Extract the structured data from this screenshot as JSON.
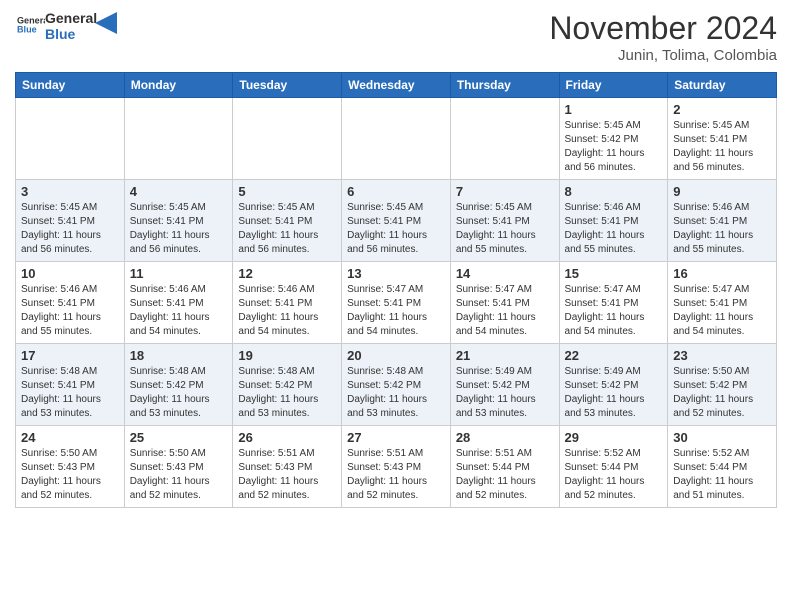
{
  "header": {
    "logo_general": "General",
    "logo_blue": "Blue",
    "month_title": "November 2024",
    "location": "Junin, Tolima, Colombia"
  },
  "calendar": {
    "days_of_week": [
      "Sunday",
      "Monday",
      "Tuesday",
      "Wednesday",
      "Thursday",
      "Friday",
      "Saturday"
    ],
    "weeks": [
      [
        {
          "day": "",
          "info": ""
        },
        {
          "day": "",
          "info": ""
        },
        {
          "day": "",
          "info": ""
        },
        {
          "day": "",
          "info": ""
        },
        {
          "day": "",
          "info": ""
        },
        {
          "day": "1",
          "info": "Sunrise: 5:45 AM\nSunset: 5:42 PM\nDaylight: 11 hours\nand 56 minutes."
        },
        {
          "day": "2",
          "info": "Sunrise: 5:45 AM\nSunset: 5:41 PM\nDaylight: 11 hours\nand 56 minutes."
        }
      ],
      [
        {
          "day": "3",
          "info": "Sunrise: 5:45 AM\nSunset: 5:41 PM\nDaylight: 11 hours\nand 56 minutes."
        },
        {
          "day": "4",
          "info": "Sunrise: 5:45 AM\nSunset: 5:41 PM\nDaylight: 11 hours\nand 56 minutes."
        },
        {
          "day": "5",
          "info": "Sunrise: 5:45 AM\nSunset: 5:41 PM\nDaylight: 11 hours\nand 56 minutes."
        },
        {
          "day": "6",
          "info": "Sunrise: 5:45 AM\nSunset: 5:41 PM\nDaylight: 11 hours\nand 56 minutes."
        },
        {
          "day": "7",
          "info": "Sunrise: 5:45 AM\nSunset: 5:41 PM\nDaylight: 11 hours\nand 55 minutes."
        },
        {
          "day": "8",
          "info": "Sunrise: 5:46 AM\nSunset: 5:41 PM\nDaylight: 11 hours\nand 55 minutes."
        },
        {
          "day": "9",
          "info": "Sunrise: 5:46 AM\nSunset: 5:41 PM\nDaylight: 11 hours\nand 55 minutes."
        }
      ],
      [
        {
          "day": "10",
          "info": "Sunrise: 5:46 AM\nSunset: 5:41 PM\nDaylight: 11 hours\nand 55 minutes."
        },
        {
          "day": "11",
          "info": "Sunrise: 5:46 AM\nSunset: 5:41 PM\nDaylight: 11 hours\nand 54 minutes."
        },
        {
          "day": "12",
          "info": "Sunrise: 5:46 AM\nSunset: 5:41 PM\nDaylight: 11 hours\nand 54 minutes."
        },
        {
          "day": "13",
          "info": "Sunrise: 5:47 AM\nSunset: 5:41 PM\nDaylight: 11 hours\nand 54 minutes."
        },
        {
          "day": "14",
          "info": "Sunrise: 5:47 AM\nSunset: 5:41 PM\nDaylight: 11 hours\nand 54 minutes."
        },
        {
          "day": "15",
          "info": "Sunrise: 5:47 AM\nSunset: 5:41 PM\nDaylight: 11 hours\nand 54 minutes."
        },
        {
          "day": "16",
          "info": "Sunrise: 5:47 AM\nSunset: 5:41 PM\nDaylight: 11 hours\nand 54 minutes."
        }
      ],
      [
        {
          "day": "17",
          "info": "Sunrise: 5:48 AM\nSunset: 5:41 PM\nDaylight: 11 hours\nand 53 minutes."
        },
        {
          "day": "18",
          "info": "Sunrise: 5:48 AM\nSunset: 5:42 PM\nDaylight: 11 hours\nand 53 minutes."
        },
        {
          "day": "19",
          "info": "Sunrise: 5:48 AM\nSunset: 5:42 PM\nDaylight: 11 hours\nand 53 minutes."
        },
        {
          "day": "20",
          "info": "Sunrise: 5:48 AM\nSunset: 5:42 PM\nDaylight: 11 hours\nand 53 minutes."
        },
        {
          "day": "21",
          "info": "Sunrise: 5:49 AM\nSunset: 5:42 PM\nDaylight: 11 hours\nand 53 minutes."
        },
        {
          "day": "22",
          "info": "Sunrise: 5:49 AM\nSunset: 5:42 PM\nDaylight: 11 hours\nand 53 minutes."
        },
        {
          "day": "23",
          "info": "Sunrise: 5:50 AM\nSunset: 5:42 PM\nDaylight: 11 hours\nand 52 minutes."
        }
      ],
      [
        {
          "day": "24",
          "info": "Sunrise: 5:50 AM\nSunset: 5:43 PM\nDaylight: 11 hours\nand 52 minutes."
        },
        {
          "day": "25",
          "info": "Sunrise: 5:50 AM\nSunset: 5:43 PM\nDaylight: 11 hours\nand 52 minutes."
        },
        {
          "day": "26",
          "info": "Sunrise: 5:51 AM\nSunset: 5:43 PM\nDaylight: 11 hours\nand 52 minutes."
        },
        {
          "day": "27",
          "info": "Sunrise: 5:51 AM\nSunset: 5:43 PM\nDaylight: 11 hours\nand 52 minutes."
        },
        {
          "day": "28",
          "info": "Sunrise: 5:51 AM\nSunset: 5:44 PM\nDaylight: 11 hours\nand 52 minutes."
        },
        {
          "day": "29",
          "info": "Sunrise: 5:52 AM\nSunset: 5:44 PM\nDaylight: 11 hours\nand 52 minutes."
        },
        {
          "day": "30",
          "info": "Sunrise: 5:52 AM\nSunset: 5:44 PM\nDaylight: 11 hours\nand 51 minutes."
        }
      ]
    ]
  }
}
